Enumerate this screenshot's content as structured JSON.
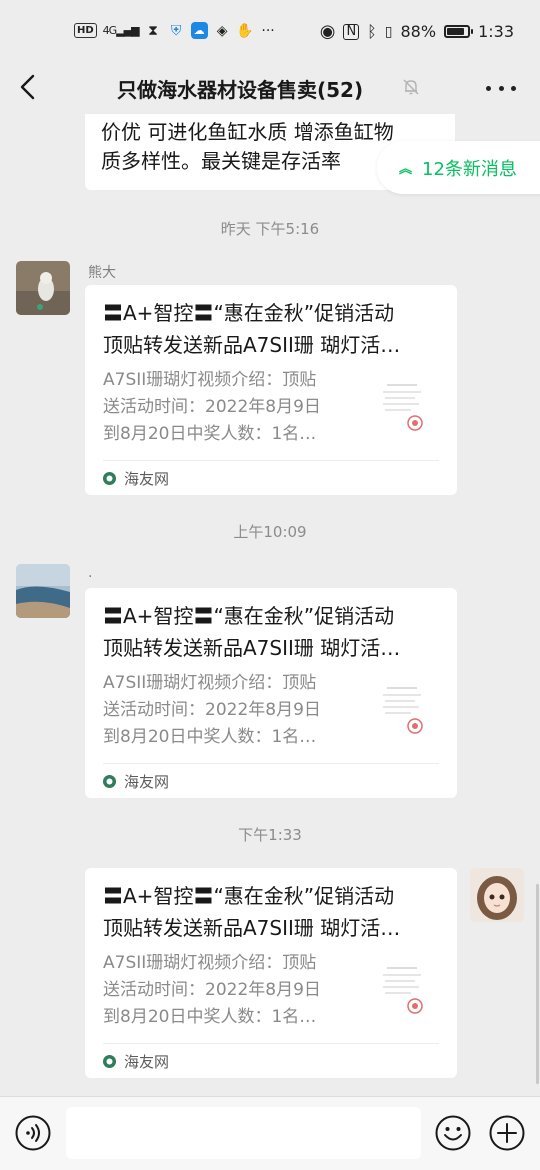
{
  "status_bar": {
    "hd": "HD",
    "network": "4G",
    "battery_text": "88%",
    "battery_level": 0.88,
    "time": "1:33",
    "icons": [
      "hourglass-icon",
      "shield-icon",
      "cloud-icon",
      "app-icon",
      "glove-icon",
      "more-dots-icon",
      "eye-icon",
      "nfc-icon",
      "bluetooth-icon",
      "vibrate-icon",
      "battery-icon"
    ]
  },
  "nav": {
    "title": "只做海水器材设备售卖(52)",
    "icons": [
      "back-icon",
      "mute-bell-icon",
      "more-icon"
    ]
  },
  "chat": {
    "top_bubble_lines": [
      "价优 可进化鱼缸水质 增添鱼缸物",
      "质多样性。最关键是存活率"
    ],
    "new_messages": "12条新消息",
    "messages": [
      {
        "timestamp": "昨天 下午5:16",
        "sender": "熊大",
        "card": {
          "title_line1": "〓A+智控〓“惠在金秋”促销活动",
          "title_line2": "顶贴转发送新品A7SII珊 瑚灯活…",
          "desc_line1": "A7SII珊瑚灯视频介绍：顶贴",
          "desc_line2": "送活动时间：2022年8月9日",
          "desc_line3": "到8月20日中奖人数：1名…",
          "source": "海友网"
        }
      },
      {
        "timestamp": "上午10:09",
        "sender": ".",
        "card": {
          "title_line1": "〓A+智控〓“惠在金秋”促销活动",
          "title_line2": "顶贴转发送新品A7SII珊 瑚灯活…",
          "desc_line1": "A7SII珊瑚灯视频介绍：顶贴",
          "desc_line2": "送活动时间：2022年8月9日",
          "desc_line3": "到8月20日中奖人数：1名…",
          "source": "海友网"
        }
      },
      {
        "timestamp": "下午1:33",
        "card": {
          "title_line1": "〓A+智控〓“惠在金秋”促销活动",
          "title_line2": "顶贴转发送新品A7SII珊 瑚灯活…",
          "desc_line1": "A7SII珊瑚灯视频介绍：顶贴",
          "desc_line2": "送活动时间：2022年8月9日",
          "desc_line3": "到8月20日中奖人数：1名…",
          "source": "海友网"
        }
      }
    ]
  },
  "input_bar": {
    "placeholder": "",
    "icons": [
      "voice-icon",
      "emoji-icon",
      "plus-icon"
    ]
  },
  "colors": {
    "background": "#ededed",
    "accent": "#07c160",
    "bubble": "#ffffff",
    "meta_text": "#8c8c8c"
  }
}
